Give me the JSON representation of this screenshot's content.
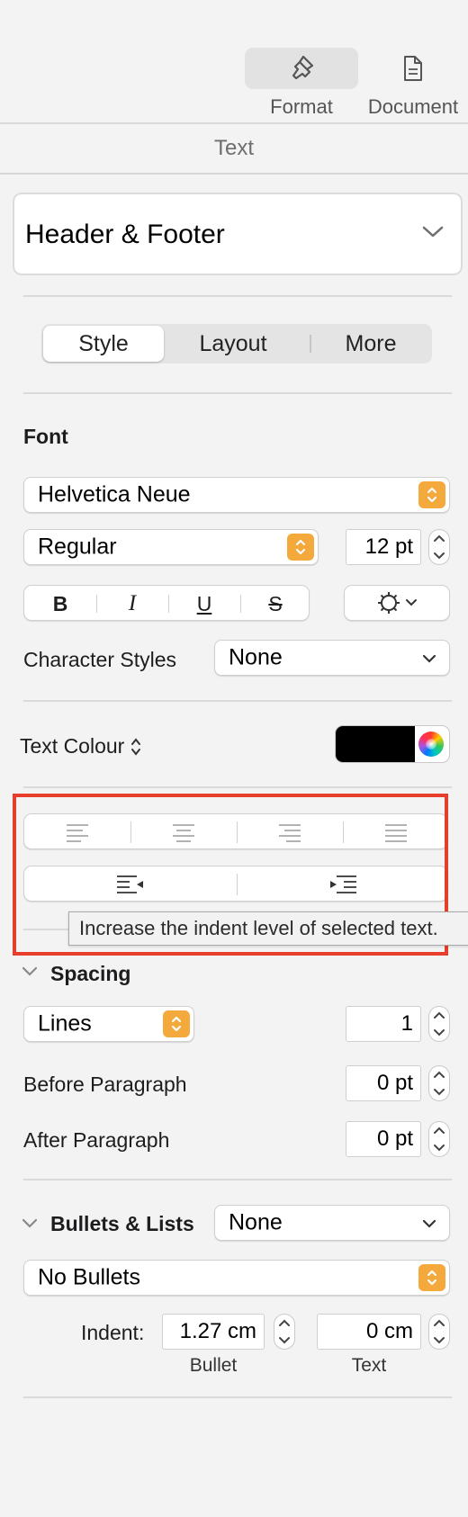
{
  "toolbar": {
    "format_label": "Format",
    "document_label": "Document"
  },
  "tab_title": "Text",
  "paragraph_style": {
    "value": "Header & Footer"
  },
  "segments": {
    "style": "Style",
    "layout": "Layout",
    "more": "More",
    "selected": "Style"
  },
  "font": {
    "section_title": "Font",
    "family": "Helvetica Neue",
    "typeface": "Regular",
    "size": "12 pt",
    "char_styles_label": "Character Styles",
    "char_styles_value": "None"
  },
  "text_colour": {
    "label": "Text Colour",
    "swatch_color": "#000000"
  },
  "tooltip": "Increase the indent level of selected text.",
  "spacing": {
    "title": "Spacing",
    "mode": "Lines",
    "line_value": "1",
    "before_label": "Before Paragraph",
    "before_value": "0 pt",
    "after_label": "After Paragraph",
    "after_value": "0 pt"
  },
  "bullets": {
    "title": "Bullets & Lists",
    "list_value": "None",
    "bullet_type": "No Bullets",
    "indent_label": "Indent:",
    "bullet_indent": "1.27 cm",
    "text_indent": "0 cm",
    "bullet_caption": "Bullet",
    "text_caption": "Text"
  },
  "colors": {
    "accent_orange": "#f3a93b",
    "highlight_red": "#e63e2a"
  }
}
